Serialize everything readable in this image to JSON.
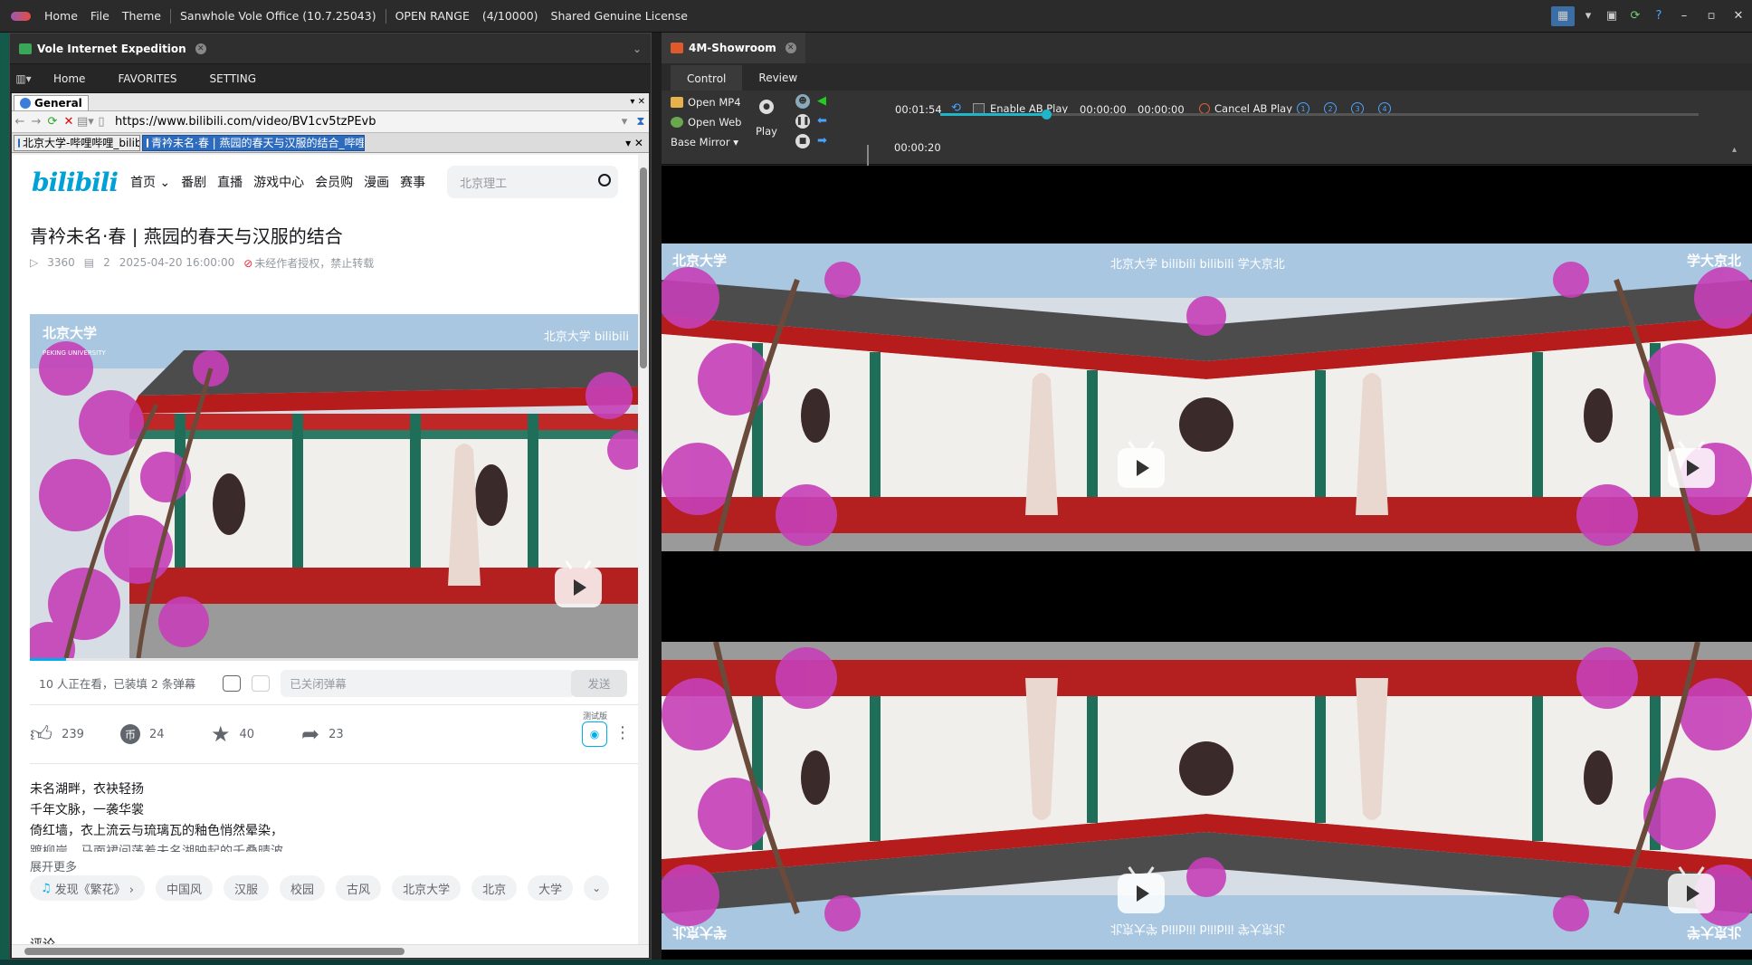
{
  "titlebar": {
    "items": [
      "Home",
      "File",
      "Theme",
      "Sanwhole Vole Office (10.7.25043)",
      "OPEN RANGE",
      "(4/10000)",
      "Shared Genuine License"
    ],
    "window_controls": [
      "–",
      "▫",
      "✕"
    ]
  },
  "left_pane": {
    "tab_title": "Vole Internet Expedition",
    "menu": [
      "Home",
      "FAVORITES",
      "SETTING"
    ],
    "browser": {
      "group_tab": "General",
      "url": "https://www.bilibili.com/video/BV1cv5tzPEvb",
      "tabs": [
        "北京大学-哔哩哔哩_bilibili",
        "青衿未名·春 | 燕园的春天与汉服的结合_哔哩哔..."
      ]
    },
    "bili": {
      "logo": "bilibili",
      "nav": [
        "首页 ⌄",
        "番剧",
        "直播",
        "游戏中心",
        "会员购",
        "漫画",
        "赛事"
      ],
      "search_placeholder": "北京理工",
      "title": "青衿未名·春 | 燕园的春天与汉服的结合",
      "views": "3360",
      "danmaku": "2",
      "date": "2025-04-20 16:00:00",
      "copyright": "未经作者授权，禁止转载",
      "watermark_left": "北京大学",
      "watermark_sub": "PEKING UNIVERSITY",
      "watermark_right": "北京大学 bilibili",
      "progress": 0.06,
      "danmaku_bar": {
        "watching": "10 人正在看，已装填 2 条弹幕",
        "input_placeholder": "已关闭弹幕",
        "send": "发送"
      },
      "actions": {
        "like": "239",
        "coin": "24",
        "fav": "40",
        "share": "23",
        "beta": "测试版"
      },
      "description": [
        "未名湖畔，衣袂轻扬",
        "千年文脉，一袭华裳",
        "倚红墙，衣上流云与琉璃瓦的釉色悄然晕染，",
        "踱柳岸，马面裙间荡着未名湖映起的千叠晴波"
      ],
      "expand": "展开更多",
      "tags": [
        "发现《繁花》 ›",
        "中国风",
        "汉服",
        "校园",
        "古风",
        "北京大学",
        "北京",
        "大学"
      ],
      "bottom_text": "评论"
    }
  },
  "right_pane": {
    "tab_title": "4M-Showroom",
    "subtabs": [
      "Control",
      "Review"
    ],
    "controls": {
      "open_mp4": "Open MP4",
      "open_web": "Open Web",
      "base_mirror": "Base Mirror ▾",
      "play": "Play",
      "duration": "00:01:54",
      "position": "00:00:20",
      "enable_ab": "Enable AB Play",
      "ab_start": "00:00:00",
      "ab_end": "00:00:00",
      "cancel_ab": "Cancel AB Play",
      "ab_slots": [
        "1",
        "2",
        "3",
        "4"
      ],
      "progress": 0.14
    },
    "frame_watermarks": {
      "top_left": "北京大学",
      "top_center": "北京大学 bilibili  bilibili 学大京北",
      "top_right": "学大京北"
    }
  },
  "colors": {
    "accent": "#00aeec",
    "slider": "#1fb6c9",
    "pink": "#c640b8"
  }
}
